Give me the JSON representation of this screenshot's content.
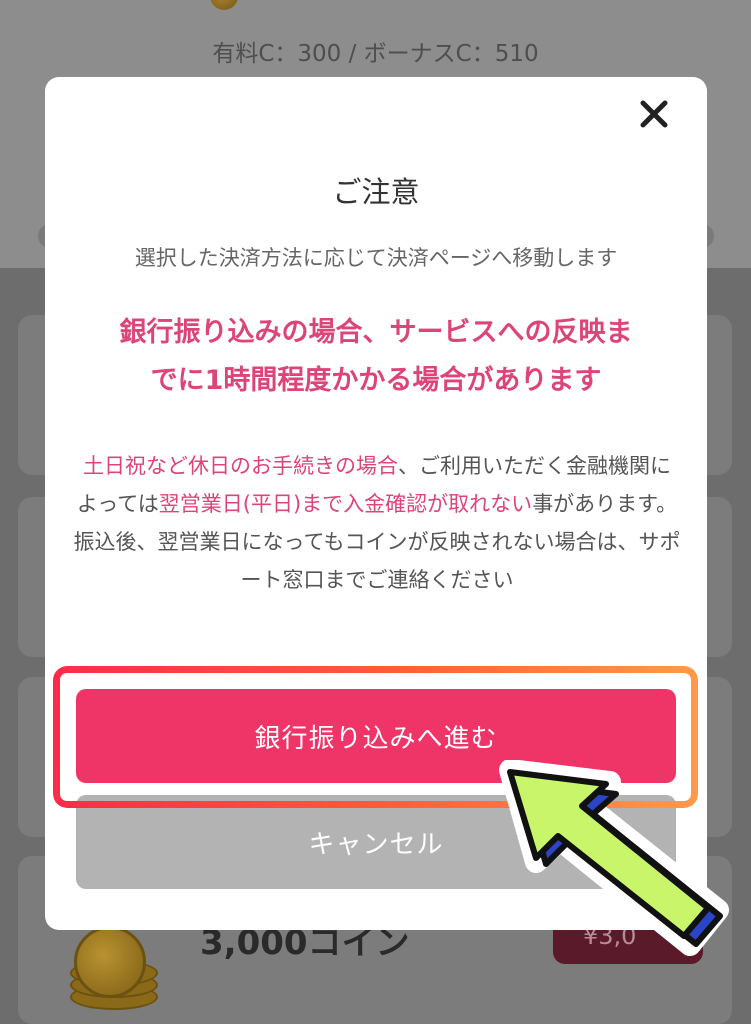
{
  "background": {
    "balance": "有料C：300 / ボーナスC：510",
    "coin_item": {
      "label": "3,000コイン",
      "price": "¥3,0"
    }
  },
  "modal": {
    "title": "ご注意",
    "intro": "選択した決済方法に応じて決済ページへ移動します",
    "warning_line1": "銀行振り込みの場合、サービスへの反映ま",
    "warning_line2": "でに1時間程度かかる場合があります",
    "notice": {
      "part1_highlight": "土日祝など休日のお手続きの場合",
      "part2": "、ご利用いただく金融機関によっては",
      "part3_highlight": "翌営業日(平日)まで入金確認が取れない",
      "part4": "事があります。振込後、翌営業日になってもコインが反映されない場合は、サポート窓口までご連絡ください"
    },
    "primary_button": "銀行振り込みへ進む",
    "cancel_button": "キャンセル",
    "close_icon": "close-icon"
  },
  "colors": {
    "accent": "#ef3568",
    "warning_text": "#dd4477",
    "cancel": "#b3b3b3",
    "highlight_border": "#ff5a3a",
    "arrow_fill": "#c8f56a"
  }
}
